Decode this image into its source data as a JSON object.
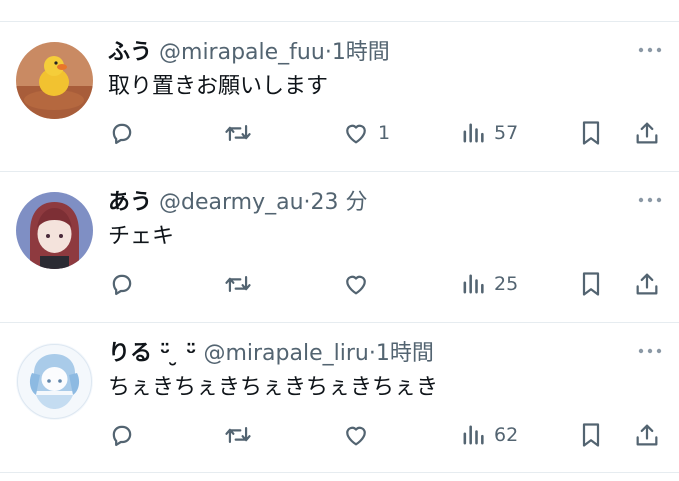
{
  "tweets": [
    {
      "name": "ふう",
      "handle": "@mirapale_fuu",
      "separator": "·",
      "time": "1時間",
      "text": "取り置きお願いします",
      "more_label": "···",
      "likes": "1",
      "views": "57",
      "avatar": "duck-avatar"
    },
    {
      "name": "あう",
      "handle": "@dearmy_au",
      "separator": "·",
      "time": "23 分",
      "text": "チェキ",
      "more_label": "···",
      "likes": "",
      "views": "25",
      "avatar": "anime-girl-avatar"
    },
    {
      "name": "りる ᵕ̈ ̮ ᵕ̈",
      "handle": "@mirapale_liru",
      "separator": "·",
      "time": "1時間",
      "text": "ちぇきちぇきちぇきちぇきちぇき",
      "more_label": "···",
      "likes": "",
      "views": "62",
      "avatar": "blue-character-avatar"
    }
  ],
  "colors": {
    "icon": "#536471",
    "divider": "#e6ecf0",
    "text": "#0f1419"
  }
}
